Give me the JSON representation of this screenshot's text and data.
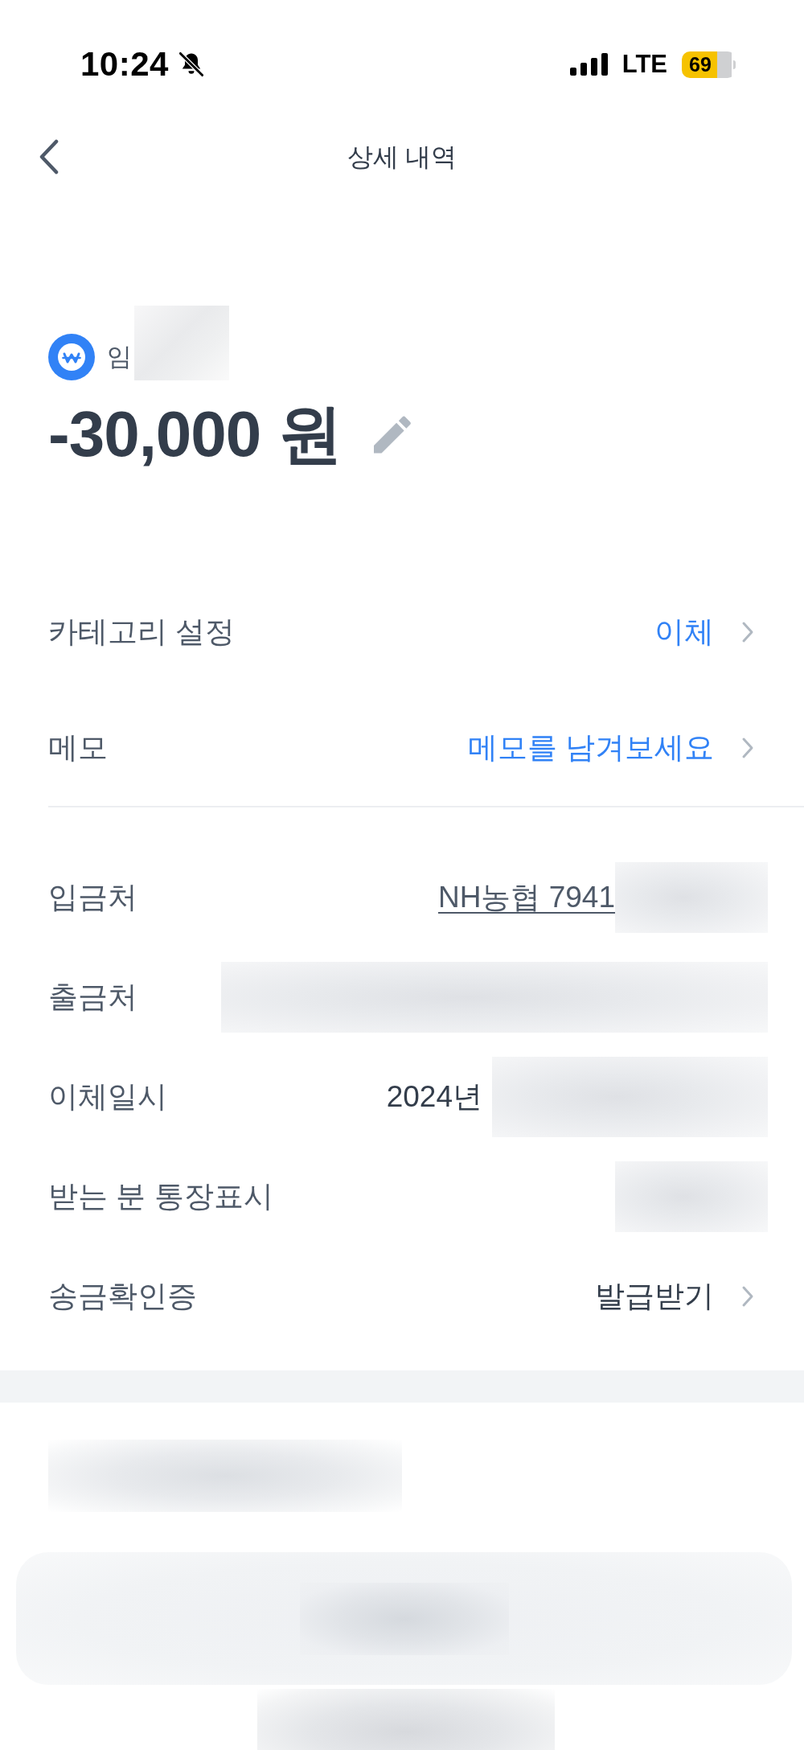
{
  "status_bar": {
    "time": "10:24",
    "network": "LTE",
    "battery": "69"
  },
  "header": {
    "title": "상세 내역"
  },
  "summary": {
    "name": "임",
    "redacted": true,
    "amount": "-30,000 원"
  },
  "settings_rows": [
    {
      "label": "카테고리 설정",
      "value": "이체",
      "kind": "accent_link"
    },
    {
      "label": "메모",
      "value": "메모를 남겨보세요",
      "kind": "accent_link"
    }
  ],
  "detail_rows": [
    {
      "label": "입금처",
      "value": "NH농협 7941",
      "kind": "underlined",
      "redacted": true
    },
    {
      "label": "출금처",
      "kind": "hidden",
      "redacted": true
    },
    {
      "label": "이체일시",
      "value": "2024년",
      "kind": "plain",
      "redacted": true
    },
    {
      "label": "받는 분 통장표시",
      "kind": "plain",
      "redacted": true
    },
    {
      "label": "송금확인증",
      "value": "발급받기",
      "kind": "link"
    }
  ]
}
